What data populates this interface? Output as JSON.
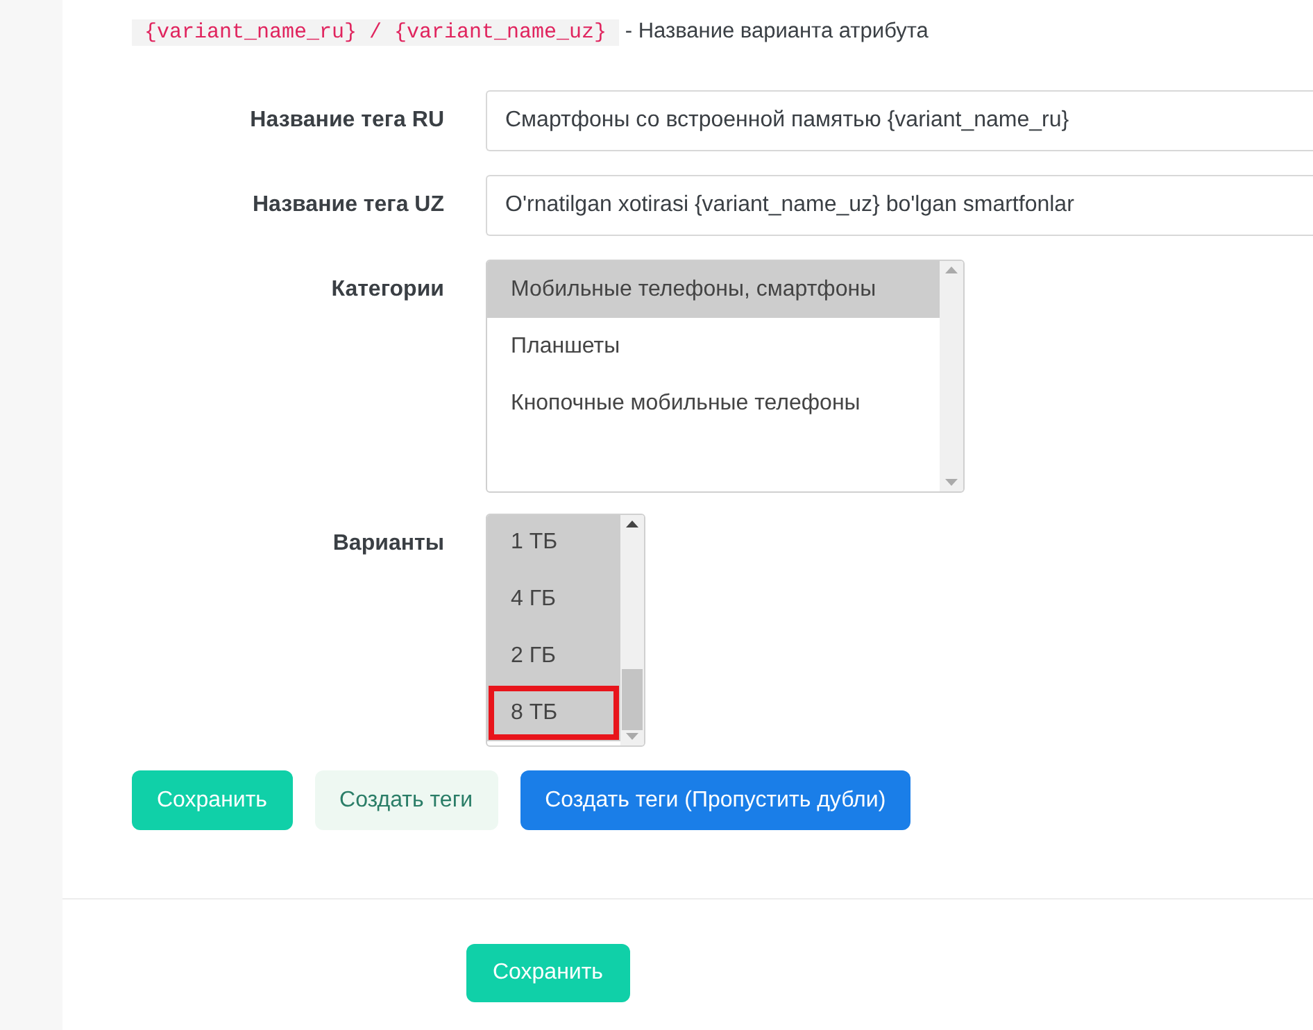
{
  "placeholders_help": [
    {
      "codes": "{variant_name_ru} / {variant_name_uz}",
      "description": "- Название варианта атрибута"
    }
  ],
  "fields": [
    {
      "label": "Название тега RU",
      "value": "Смартфоны со встроенной памятью {variant_name_ru}"
    },
    {
      "label": "Название тега UZ",
      "value": "O'rnatilgan xotirasi {variant_name_uz} bo'lgan smartfonlar"
    }
  ],
  "categories": {
    "label": "Категории",
    "options": [
      {
        "text": "Мобильные телефоны, смартфоны",
        "selected": true
      },
      {
        "text": "Планшеты",
        "selected": false
      },
      {
        "text": "Кнопочные мобильные телефоны",
        "selected": false
      }
    ]
  },
  "variants": {
    "label": "Варианты",
    "options": [
      {
        "text": "1 ТБ",
        "selected": true,
        "highlighted": false
      },
      {
        "text": "4 ГБ",
        "selected": true,
        "highlighted": false
      },
      {
        "text": "2 ГБ",
        "selected": true,
        "highlighted": false
      },
      {
        "text": "8 ТБ",
        "selected": true,
        "highlighted": true
      }
    ]
  },
  "buttons": [
    {
      "label": "Сохранить",
      "kind": "success"
    },
    {
      "label": "Создать теги",
      "kind": "light"
    },
    {
      "label": "Создать теги (Пропустить дубли)",
      "kind": "primary"
    }
  ],
  "footer_button": {
    "label": "Сохранить"
  }
}
